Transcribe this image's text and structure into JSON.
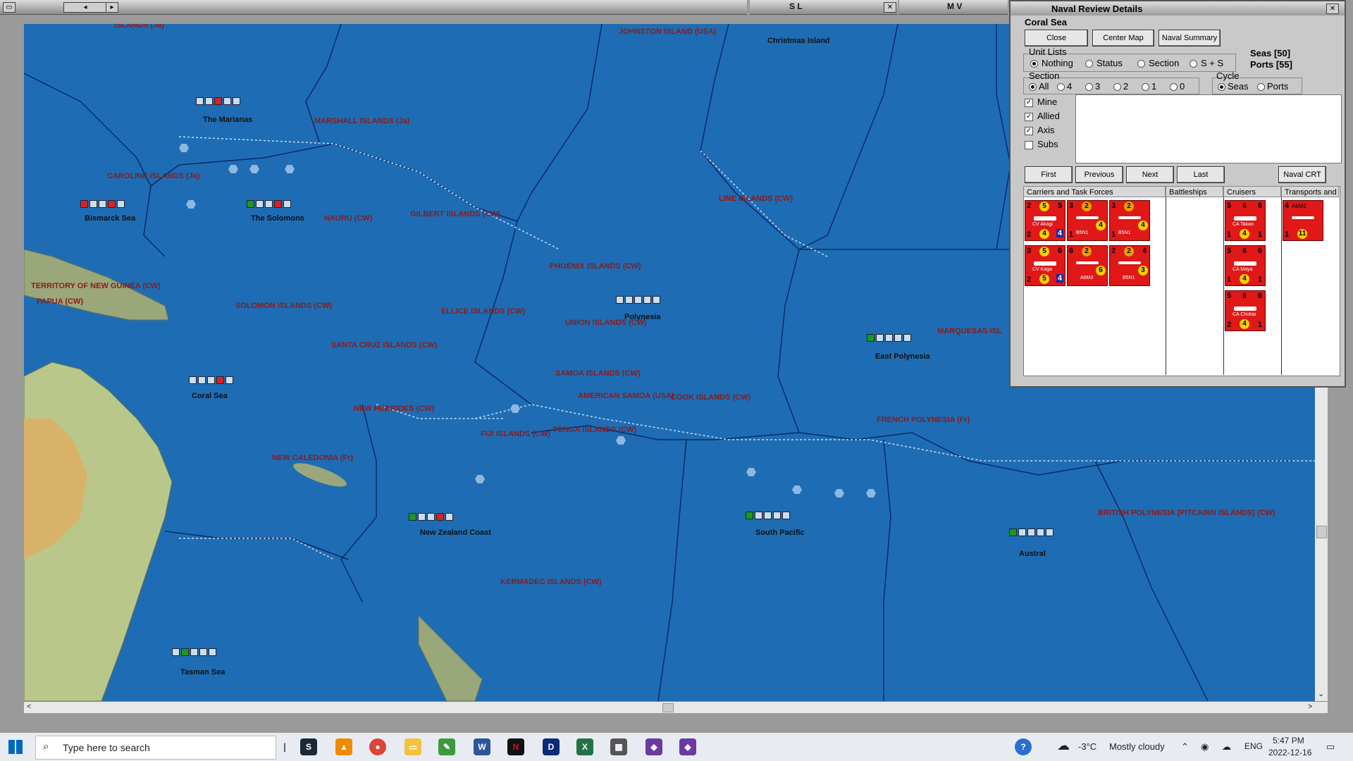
{
  "windows": {
    "left_title": "",
    "sl_title": "S L",
    "mv_title": "M V"
  },
  "map": {
    "labels": {
      "marianas_top": "ISLANDS (Ja)",
      "johnston": "JOHNSTON ISLAND (USA)",
      "christmas": "Christmas Island",
      "marianas": "The Marianas",
      "marshall": "MARSHALL ISLANDS (Ja)",
      "caroline": "CAROLINE ISLANDS (Ja)",
      "bismarck": "Bismarck Sea",
      "solomons": "The Solomons",
      "nauru": "NAURU (CW)",
      "gilbert": "GILBERT ISLANDS (CW)",
      "line": "LINE ISLANDS (CW)",
      "new_guinea": "TERRITORY OF NEW GUINEA (CW)",
      "papua": "PAPUA (CW)",
      "phoenix": "PHOENIX ISLANDS (CW)",
      "solomon_isl": "SOLOMON ISLANDS (CW)",
      "ellice": "ELLICE ISLANDS (CW)",
      "polynesia": "Polynesia",
      "union": "UNION ISLANDS (CW)",
      "marquesas": "MARQUESAS ISL",
      "east_polynesia": "East Polynesia",
      "santa_cruz": "SANTA CRUZ ISLANDS (CW)",
      "coral_sea": "Coral Sea",
      "samoa": "SAMOA ISLANDS (CW)",
      "american_samoa": "AMERICAN SAMOA (USA)",
      "cook": "COOK ISLANDS (CW)",
      "new_hebrides": "NEW HEBRIDES (CW)",
      "french_polynesia": "FRENCH POLYNESIA (Fr)",
      "fiji": "FIJI ISLANDS (CW)",
      "tonga": "TONGA ISLANDS (CW)",
      "new_caledonia": "NEW CALEDONIA (Fr)",
      "british_polynesia": "BRITISH POLYNESIA (PITCAIRN ISLANDS) (CW)",
      "nz_coast": "New Zealand Coast",
      "south_pacific": "South Pacific",
      "austral": "Austral",
      "kermadec": "KERMADEC ISLANDS (CW)",
      "tasman": "Tasman Sea"
    }
  },
  "panel": {
    "title": "Naval Review Details",
    "sea_name": "Coral Sea",
    "buttons": {
      "close": "Close",
      "center_map": "Center Map",
      "naval_summary": "Naval Summary"
    },
    "seas_count": "Seas [50]",
    "ports_count": "Ports [55]",
    "unit_lists": {
      "label": "Unit Lists",
      "options": [
        "Nothing",
        "Status",
        "Section",
        "S + S"
      ],
      "selected": "Nothing"
    },
    "section": {
      "label": "Section",
      "options": [
        "All",
        "4",
        "3",
        "2",
        "1",
        "0"
      ],
      "selected": "All"
    },
    "cycle": {
      "label": "Cycle",
      "options": [
        "Seas",
        "Ports"
      ],
      "selected": "Seas"
    },
    "filters": [
      {
        "label": "Mine",
        "checked": true
      },
      {
        "label": "Allied",
        "checked": true
      },
      {
        "label": "Axis",
        "checked": true
      },
      {
        "label": "Subs",
        "checked": false
      }
    ],
    "nav": {
      "first": "First",
      "previous": "Previous",
      "next": "Next",
      "last": "Last",
      "naval_crt": "Naval CRT"
    },
    "columns": [
      "Carriers and Task Forces",
      "Battleships",
      "Cruisers",
      "Transports and"
    ],
    "carriers": [
      {
        "tl": "2",
        "tc": "5",
        "tr": "5",
        "bl": "2",
        "bc": "4",
        "br": "4",
        "name": "CV Akagi"
      },
      {
        "tl": "3",
        "tc": "2",
        "tr": "",
        "bl": "1",
        "bc": "4",
        "br": "",
        "name": "B5N1"
      },
      {
        "tl": "3",
        "tc": "2",
        "tr": "",
        "bl": "1",
        "bc": "4",
        "br": "",
        "name": "B5N1"
      },
      {
        "tl": "3",
        "tc": "5",
        "tr": "6",
        "bl": "2",
        "bc": "5",
        "br": "4",
        "name": "CV Kaga"
      },
      {
        "tl": "6",
        "tc": "2",
        "tr": "",
        "bl": "",
        "bc": "6",
        "br": "",
        "name": "A6M3"
      },
      {
        "tl": "2",
        "tc": "2",
        "tr": "4",
        "bl": "",
        "bc": "3",
        "br": "",
        "name": "B5N1"
      }
    ],
    "cruisers": [
      {
        "tl": "5",
        "tc": "6",
        "tr": "6",
        "bl": "1",
        "bc": "4",
        "br": "1",
        "name": "CA Takao"
      },
      {
        "tl": "5",
        "tc": "6",
        "tr": "6",
        "bl": "1",
        "bc": "4",
        "br": "1",
        "name": "CA Maya"
      },
      {
        "tl": "5",
        "tc": "6",
        "tr": "6",
        "bl": "2",
        "bc": "4",
        "br": "1",
        "name": "CA Chokai"
      }
    ],
    "transports": [
      {
        "tl": "4",
        "tc": "A6M2",
        "tr": "",
        "bl": "1",
        "bc": "11",
        "br": "",
        "name": ""
      }
    ]
  },
  "taskbar": {
    "search_placeholder": "Type here to search",
    "weather_temp": "-3°C",
    "weather_desc": "Mostly cloudy",
    "lang": "ENG",
    "time": "5:47 PM",
    "date": "2022-12-16",
    "colors": {
      "start": "#0067c0",
      "taskbar": "#e8ecf2"
    }
  }
}
